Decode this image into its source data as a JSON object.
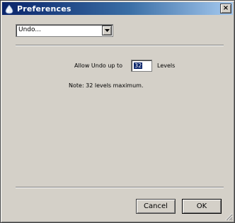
{
  "window": {
    "title": "Preferences",
    "close_label": "×",
    "title_bar_color": "#0a246a",
    "background_color": "#d4d0c8"
  },
  "category_dropdown": {
    "selected": "Undo..."
  },
  "undo": {
    "allow_label": "Allow Undo up to",
    "levels_value": "32",
    "levels_label": "Levels",
    "note": "Note: 32 levels maximum."
  },
  "buttons": {
    "cancel_label": "Cancel",
    "ok_label": "OK"
  },
  "icons": {
    "title_icon": "app-drop-icon",
    "dropdown_arrow": "chevron-down-icon",
    "resize_grip": "resize-grip-icon"
  }
}
